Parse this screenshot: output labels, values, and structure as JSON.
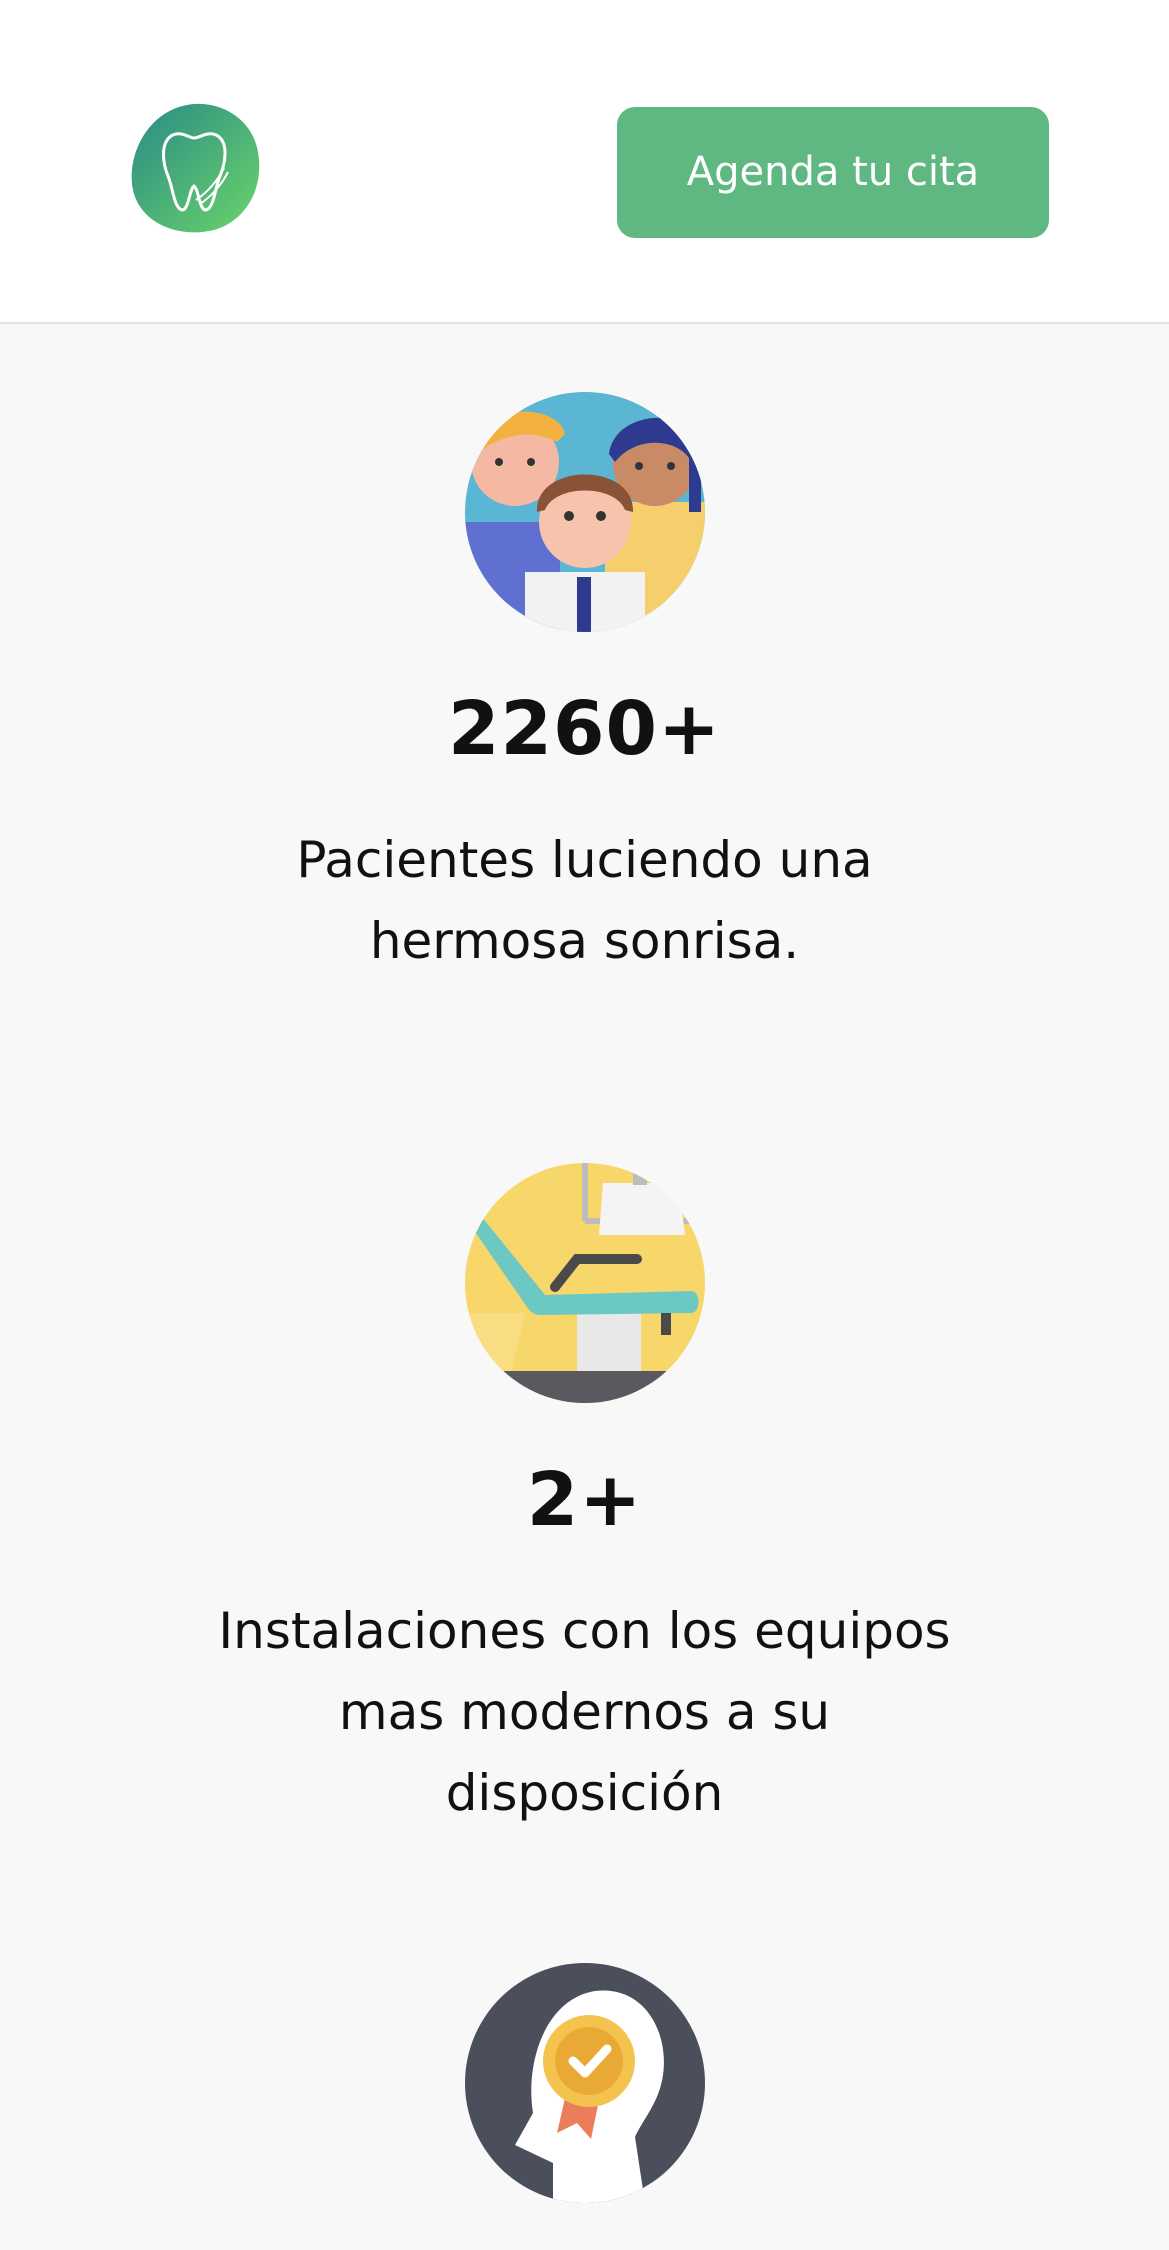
{
  "header": {
    "logo_icon": "tooth-logo-icon",
    "cta_label": "Agenda tu cita",
    "cta_color": "#5fb881"
  },
  "stats": [
    {
      "icon": "patients-group-icon",
      "value": "2260+",
      "description": "Pacientes luciendo una hermosa sonrisa."
    },
    {
      "icon": "dental-chair-icon",
      "value": "2+",
      "description": "Instalaciones con los equipos mas modernos a su disposición"
    },
    {
      "icon": "expert-award-icon"
    }
  ],
  "colors": {
    "page_background": "#f8f8f8",
    "header_background": "#ffffff",
    "accent_green": "#5fb881"
  }
}
